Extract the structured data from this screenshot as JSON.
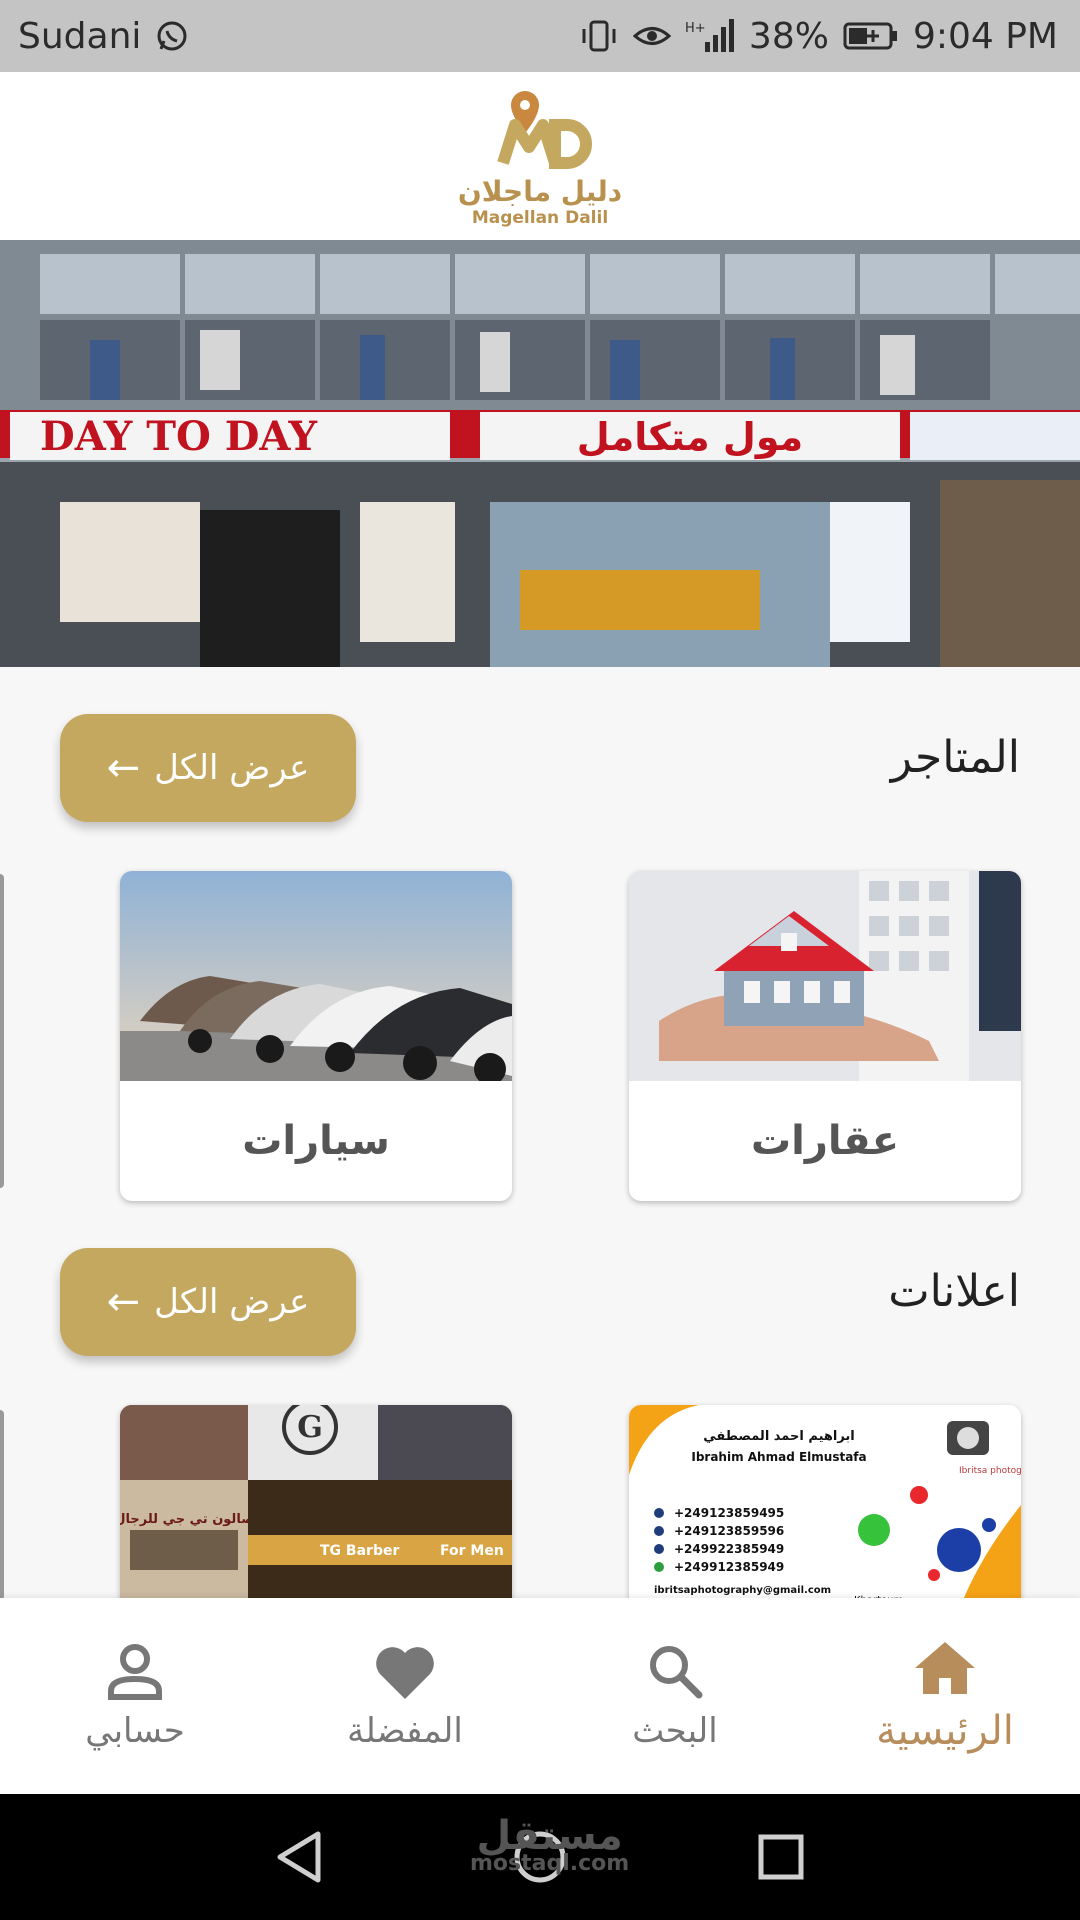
{
  "status_bar": {
    "carrier": "Sudani",
    "battery": "38%",
    "time": "9:04 PM"
  },
  "header": {
    "logo_ar": "دليل ماجلان",
    "logo_en": "Magellan Dalil",
    "logo_mark": "MD"
  },
  "hero": {
    "sign_en": "DAY TO DAY",
    "sign_ar": "مول متكامل"
  },
  "stores": {
    "title": "المتاجر",
    "view_all": "عرض الكل",
    "cards": [
      {
        "label": "عقارات"
      },
      {
        "label": "سيارات"
      }
    ]
  },
  "ads": {
    "title": "اعلانات",
    "view_all": "عرض الكل",
    "card1": {
      "name_ar": "ابراهيم احمد المصطفي",
      "name_en": "Ibrahim Ahmad Elmustafa",
      "phones": [
        "+249123859495",
        "+249123859596",
        "+249922385949",
        "+249912385949"
      ],
      "email": "ibritsaphotography@gmail.com",
      "brand": "Ibritsa photography",
      "city": "Khartoum"
    },
    "card2": {
      "tg_letter": "G",
      "sign_ar": "صالون تي جي للرجال",
      "barber": "TG Barber",
      "for_men": "For Men"
    }
  },
  "bottom_nav": {
    "home": "الرئيسية",
    "search": "البحث",
    "favorites": "المفضلة",
    "account": "حسابي"
  },
  "watermark": {
    "ar": "مستقل",
    "en": "mostaql.com"
  },
  "colors": {
    "accent": "#c5a85f",
    "active_nav": "#b88d5c",
    "status_bar": "#c4c4c4"
  }
}
